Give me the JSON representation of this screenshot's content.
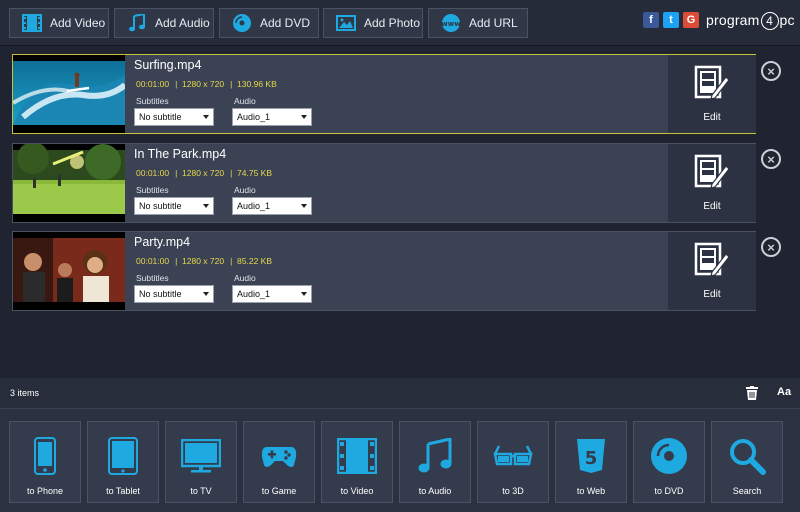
{
  "toolbar": {
    "add_video": "Add Video",
    "add_audio": "Add Audio",
    "add_dvd": "Add DVD",
    "add_photo": "Add Photo",
    "add_url": "Add URL",
    "social": {
      "facebook": "f",
      "twitter": "t",
      "google": "G"
    },
    "brand_prefix": "program",
    "brand_four": "4",
    "brand_suffix": "pc"
  },
  "items": [
    {
      "name": "Surfing.mp4",
      "duration": "00:01:00",
      "resolution": "1280 x 720",
      "size": "130.96 KB",
      "subtitles_label": "Subtitles",
      "subtitle_value": "No subtitle",
      "audio_label": "Audio",
      "audio_value": "Audio_1",
      "edit_label": "Edit",
      "selected": true
    },
    {
      "name": "In The Park.mp4",
      "duration": "00:01:00",
      "resolution": "1280 x 720",
      "size": "74.75 KB",
      "subtitles_label": "Subtitles",
      "subtitle_value": "No subtitle",
      "audio_label": "Audio",
      "audio_value": "Audio_1",
      "edit_label": "Edit",
      "selected": false
    },
    {
      "name": "Party.mp4",
      "duration": "00:01:00",
      "resolution": "1280 x 720",
      "size": "85.22 KB",
      "subtitles_label": "Subtitles",
      "subtitle_value": "No subtitle",
      "audio_label": "Audio",
      "audio_value": "Audio_1",
      "edit_label": "Edit",
      "selected": false
    }
  ],
  "status": {
    "count": "3 items",
    "font_button": "Aa"
  },
  "converters": [
    {
      "label": "to Phone",
      "icon": "phone-icon"
    },
    {
      "label": "to Tablet",
      "icon": "tablet-icon"
    },
    {
      "label": "to TV",
      "icon": "tv-icon"
    },
    {
      "label": "to Game",
      "icon": "gamepad-icon"
    },
    {
      "label": "to Video",
      "icon": "film-icon"
    },
    {
      "label": "to Audio",
      "icon": "music-icon"
    },
    {
      "label": "to 3D",
      "icon": "3d-glasses-icon"
    },
    {
      "label": "to Web",
      "icon": "html5-icon"
    },
    {
      "label": "to DVD",
      "icon": "disc-icon"
    },
    {
      "label": "Search",
      "icon": "search-icon"
    }
  ],
  "colors": {
    "accent": "#1fa9e1",
    "selected_border": "#c8c23a",
    "meta_text": "#e7d74b"
  }
}
